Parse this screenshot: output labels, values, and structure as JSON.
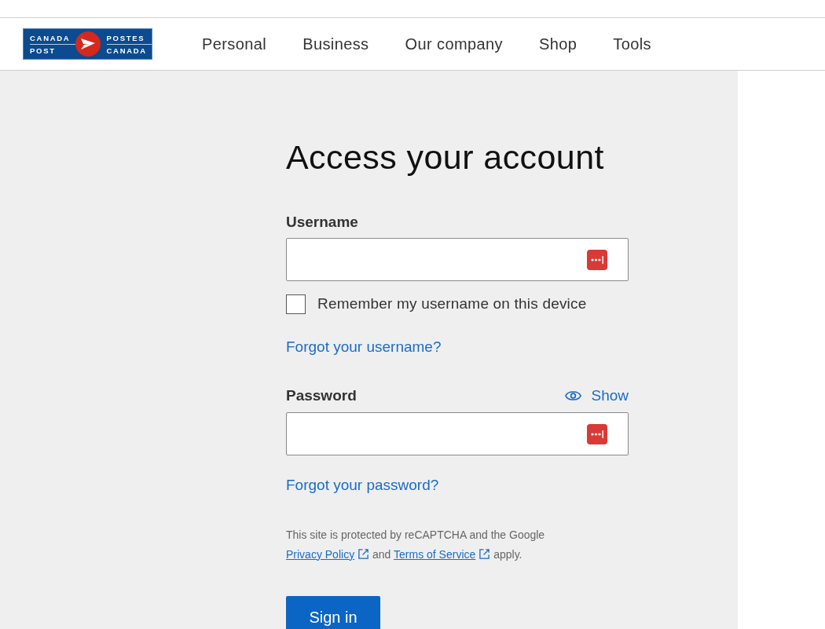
{
  "logo": {
    "top_left": "CANADA",
    "bottom_left": "POST",
    "top_right": "POSTES",
    "bottom_right": "CANADA"
  },
  "nav": [
    {
      "label": "Personal"
    },
    {
      "label": "Business"
    },
    {
      "label": "Our company"
    },
    {
      "label": "Shop"
    },
    {
      "label": "Tools"
    }
  ],
  "title": "Access your account",
  "username": {
    "label": "Username"
  },
  "remember": {
    "label": "Remember my username on this device",
    "checked": false
  },
  "forgot_username": "Forgot your username?",
  "password": {
    "label": "Password",
    "show": "Show"
  },
  "forgot_password": "Forgot your password?",
  "recaptcha": {
    "before": "This site is protected by reCAPTCHA and the Google",
    "privacy": "Privacy Policy",
    "and": "and",
    "terms": "Terms of Service",
    "after": "apply."
  },
  "sign_in": "Sign in"
}
